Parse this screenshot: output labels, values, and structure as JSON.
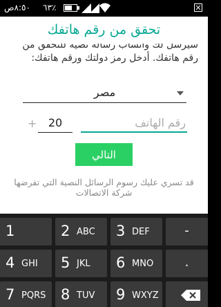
{
  "status_bar": {
    "time": "٨:٥٠ص",
    "battery": "٦٣٪",
    "battery_level": 0.63,
    "icons": [
      "signal-icon",
      "signal-icon",
      "wifi-icon",
      "notification-icon"
    ]
  },
  "screen": {
    "title": "تحقق من رقم هاتفك",
    "instruction_line1": "سيرسل لك واتساب رسالة نصية للتحقق من",
    "instruction_line2": "رقم هاتفك. أدخل رمز دولتك ورقم هاتفك:",
    "country": "مصر",
    "plus_sign": "+",
    "country_code": "20",
    "phone_placeholder": "رقم الهاتف",
    "next_button": "التالي",
    "disclaimer": "قد تسري عليك رسوم الرسائل النصية التي تفرضها شركة الاتصالات",
    "accent_color": "#08a893",
    "button_color": "#2bd064"
  },
  "keyboard": {
    "rows": [
      [
        {
          "digit": "1",
          "letters": ""
        },
        {
          "digit": "2",
          "letters": "ABC"
        },
        {
          "digit": "3",
          "letters": "DEF"
        },
        {
          "symbol": "-"
        }
      ],
      [
        {
          "digit": "4",
          "letters": "GHI"
        },
        {
          "digit": "5",
          "letters": "JKL"
        },
        {
          "digit": "6",
          "letters": "MNO"
        },
        {
          "symbol": "."
        }
      ],
      [
        {
          "digit": "7",
          "letters": "PQRS"
        },
        {
          "digit": "8",
          "letters": "TUV"
        },
        {
          "digit": "9",
          "letters": "WXYZ"
        },
        {
          "icon": "backspace-icon"
        }
      ]
    ]
  }
}
